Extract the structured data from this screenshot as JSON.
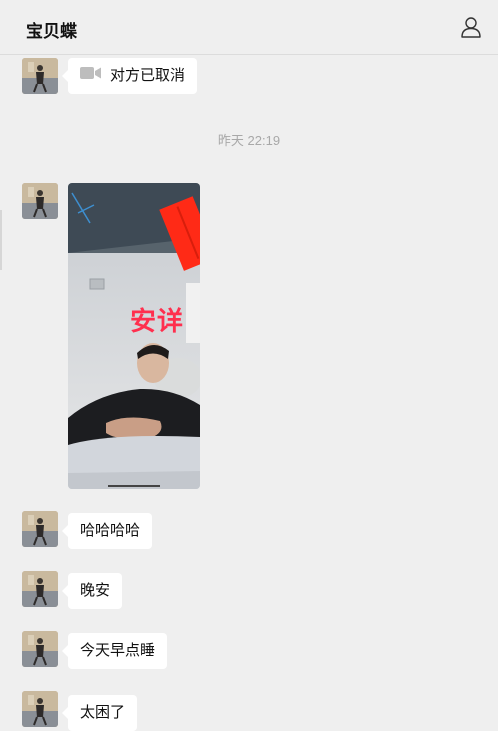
{
  "header": {
    "title": "宝贝蝶"
  },
  "messages": [
    {
      "type": "call",
      "text": "对方已取消"
    },
    {
      "type": "time",
      "text": "昨天 22:19"
    },
    {
      "type": "image",
      "overlay_text": "安详"
    },
    {
      "type": "text",
      "text": "哈哈哈哈"
    },
    {
      "type": "text",
      "text": "晚安"
    },
    {
      "type": "text",
      "text": "今天早点睡"
    },
    {
      "type": "text",
      "text": "太困了"
    }
  ],
  "colors": {
    "background": "#efefef",
    "bubble": "#ffffff",
    "timestamp": "#a8a8a8",
    "overlay_red": "#ff2a16"
  },
  "icons": [
    "user-profile-icon",
    "video-call-icon"
  ]
}
